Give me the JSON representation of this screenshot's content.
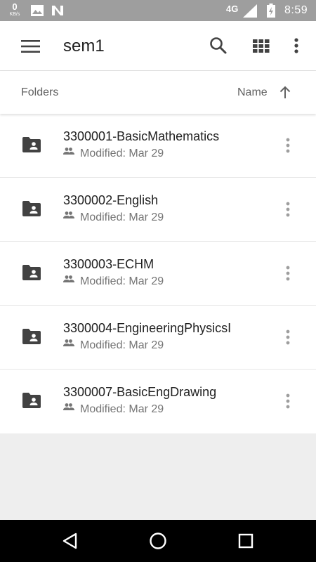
{
  "status_bar": {
    "data_rate": "0",
    "data_rate_unit": "KB/s",
    "network_type": "4G",
    "time": "8:59",
    "icons": [
      "image-icon",
      "n-notification-icon",
      "signal-icon",
      "battery-charging-icon"
    ]
  },
  "app_bar": {
    "title": "sem1",
    "icons": [
      "menu-icon",
      "search-icon",
      "grid-view-icon",
      "more-vert-icon"
    ]
  },
  "sort_bar": {
    "section_label": "Folders",
    "sort_label": "Name",
    "sort_direction_icon": "arrow-upward-icon"
  },
  "folders": [
    {
      "name": "3300001-BasicMathematics",
      "modified": "Modified: Mar 29"
    },
    {
      "name": "3300002-English",
      "modified": "Modified: Mar 29"
    },
    {
      "name": "3300003-ECHM",
      "modified": "Modified: Mar 29"
    },
    {
      "name": "3300004-EngineeringPhysicsI",
      "modified": "Modified: Mar 29"
    },
    {
      "name": "3300007-BasicEngDrawing",
      "modified": "Modified: Mar 29"
    }
  ],
  "nav_bar": {
    "icons": [
      "back-icon",
      "home-icon",
      "recents-icon"
    ]
  },
  "colors": {
    "status_bar": "#9e9e9e",
    "surface": "#ffffff",
    "background": "#eeeeee",
    "icon": "#616161",
    "primary_text": "#212121",
    "secondary_text": "#757575",
    "nav_bar": "#000000"
  }
}
